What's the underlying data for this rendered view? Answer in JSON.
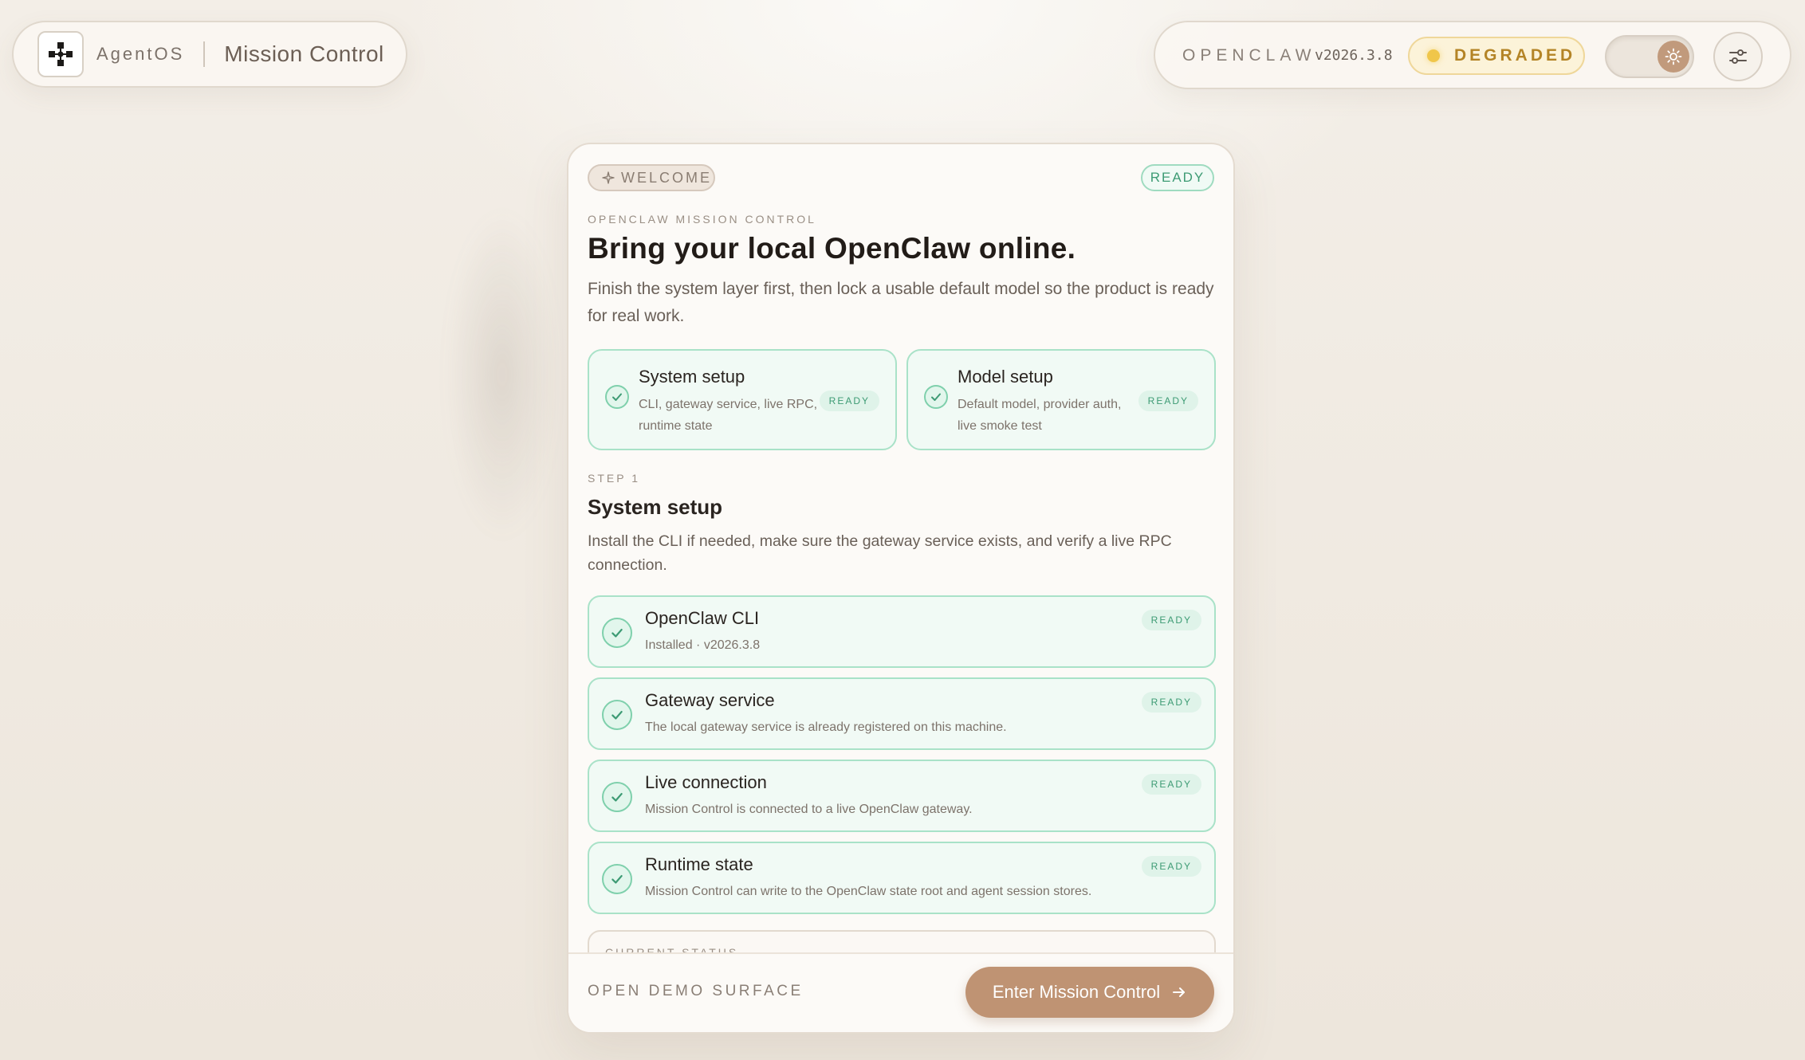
{
  "brand": {
    "name": "AgentOS",
    "title": "Mission Control"
  },
  "status": {
    "product": "OPENCLAW",
    "version": "v2026.3.8",
    "health": "DEGRADED"
  },
  "colors": {
    "accent": "#bf9373",
    "ready_green": "#3d9b74",
    "degraded_yellow": "#f0c64a"
  },
  "card": {
    "welcome_badge": "WELCOME",
    "ready_badge": "READY",
    "eyebrow": "OPENCLAW MISSION CONTROL",
    "headline": "Bring your local OpenClaw online.",
    "subtitle": "Finish the system layer first, then lock a usable default model so the product is ready for real work.",
    "setups": [
      {
        "title": "System setup",
        "desc": "CLI, gateway service, live RPC, runtime state",
        "status": "READY"
      },
      {
        "title": "Model setup",
        "desc": "Default model, provider auth, live smoke test",
        "status": "READY"
      }
    ],
    "step": {
      "eyebrow": "STEP 1",
      "title": "System setup",
      "desc": "Install the CLI if needed, make sure the gateway service exists, and verify a live RPC connection."
    },
    "checks": [
      {
        "title": "OpenClaw CLI",
        "desc": "Installed · v2026.3.8",
        "status": "READY"
      },
      {
        "title": "Gateway service",
        "desc": "The local gateway service is already registered on this machine.",
        "status": "READY"
      },
      {
        "title": "Live connection",
        "desc": "Mission Control is connected to a live OpenClaw gateway.",
        "status": "READY"
      },
      {
        "title": "Runtime state",
        "desc": "Mission Control can write to the OpenClaw state root and agent session stores.",
        "status": "READY"
      }
    ],
    "current_status_label": "CURRENT STATUS",
    "footer": {
      "demo_label": "OPEN DEMO SURFACE",
      "enter_label": "Enter Mission Control"
    }
  }
}
